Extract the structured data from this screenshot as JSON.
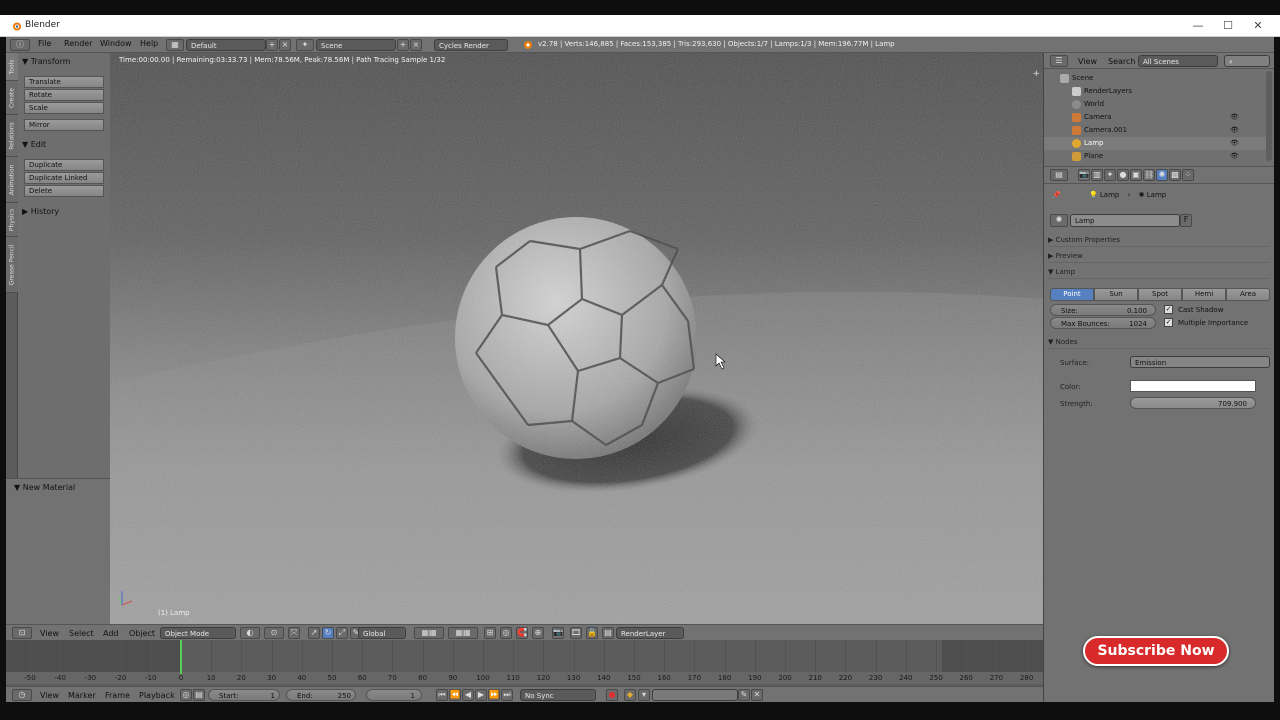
{
  "window": {
    "title": "Blender",
    "controls": [
      "—",
      "☐",
      "✕"
    ]
  },
  "topbar": {
    "menus": [
      "File",
      "Render",
      "Window",
      "Help"
    ],
    "layout": "Default",
    "scene": "Scene",
    "engine": "Cycles Render",
    "stats": "v2.78 | Verts:146,885 | Faces:153,385 | Tris:293,630 | Objects:1/7 | Lamps:1/3 | Mem:196.77M | Lamp"
  },
  "left_tabs": [
    "Tools",
    "Create",
    "Relations",
    "Animation",
    "Physics",
    "Grease Pencil"
  ],
  "tool_shelf": {
    "transform_header": "Transform",
    "transform_buttons": [
      "Translate",
      "Rotate",
      "Scale"
    ],
    "mirror": "Mirror",
    "edit_header": "Edit",
    "edit_buttons": [
      "Duplicate",
      "Duplicate Linked",
      "Delete"
    ],
    "history_header": "History",
    "new_material": "New Material"
  },
  "viewport": {
    "info": "Time:00:00.00 | Remaining:03:33.73 | Mem:78.56M, Peak:78.56M | Path Tracing Sample 1/32",
    "object_label": "(1) Lamp"
  },
  "outliner": {
    "menus": [
      "View",
      "Search"
    ],
    "filter": "All Scenes",
    "items": [
      "Scene",
      "RenderLayers",
      "World",
      "Camera",
      "Camera.001",
      "Lamp",
      "Plane"
    ]
  },
  "properties": {
    "breadcrumb": [
      "Lamp",
      "Lamp"
    ],
    "datablock": "Lamp",
    "datablock_flag": "F",
    "panels": {
      "custom": "Custom Properties",
      "preview": "Preview",
      "lamp": "Lamp",
      "nodes": "Nodes"
    },
    "lamp_types": [
      "Point",
      "Sun",
      "Spot",
      "Hemi",
      "Area"
    ],
    "active_type": "Point",
    "size_label": "Size:",
    "size_value": "0.100",
    "bounces_label": "Max Bounces:",
    "bounces_value": "1024",
    "cast_shadow": "Cast Shadow",
    "multiple_importance": "Multiple Importance",
    "surface_label": "Surface:",
    "surface_value": "Emission",
    "color_label": "Color:",
    "color_value": "#ffffff",
    "strength_label": "Strength:",
    "strength_value": "709.900"
  },
  "viewport_header": {
    "menus": [
      "View",
      "Select",
      "Add",
      "Object"
    ],
    "mode": "Object Mode",
    "orientation": "Global",
    "render_layer": "RenderLayer"
  },
  "timeline": {
    "ticks": [
      "-50",
      "-40",
      "-30",
      "-20",
      "-10",
      "0",
      "10",
      "20",
      "30",
      "40",
      "50",
      "60",
      "70",
      "80",
      "90",
      "100",
      "110",
      "120",
      "130",
      "140",
      "150",
      "160",
      "170",
      "180",
      "190",
      "200",
      "210",
      "220",
      "230",
      "240",
      "250",
      "260",
      "270",
      "280"
    ],
    "current_frame": 0,
    "menus": [
      "View",
      "Marker",
      "Frame",
      "Playback"
    ],
    "start_label": "Start:",
    "start_value": "1",
    "end_label": "End:",
    "end_value": "250",
    "frame_value": "1",
    "sync": "No Sync"
  },
  "overlay": {
    "subscribe": "Subscribe Now"
  }
}
